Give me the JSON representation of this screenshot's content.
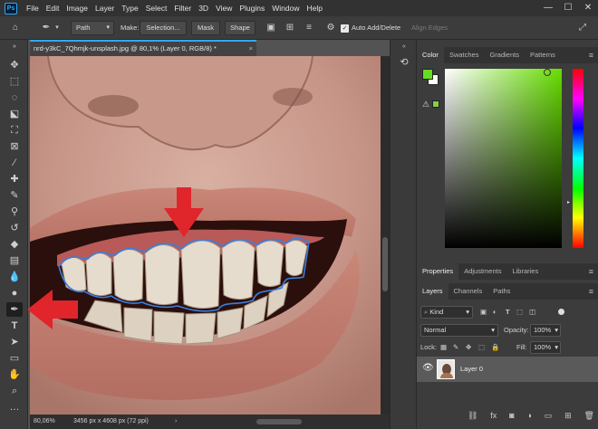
{
  "app": {
    "logo": "Ps"
  },
  "menu": [
    "File",
    "Edit",
    "Image",
    "Layer",
    "Type",
    "Select",
    "Filter",
    "3D",
    "View",
    "Plugins",
    "Window",
    "Help"
  ],
  "window_controls": {
    "minimize": "—",
    "maximize": "☐",
    "close": "✕"
  },
  "options": {
    "mode_value": "Path",
    "make_label": "Make:",
    "selection_label": "Selection...",
    "mask_label": "Mask",
    "shape_label": "Shape",
    "auto_add_delete_label": "Auto Add/Delete",
    "auto_add_delete_checked": true,
    "align_edges_label": "Align Edges"
  },
  "document": {
    "tab_title": "nrd-y3kC_7Qhmjk-unsplash.jpg @ 80,1% (Layer 0, RGB/8) *",
    "close": "×",
    "zoom": "80,06%",
    "info": "3456 px x 4608 px (72 ppi)"
  },
  "tools": [
    "move-icon",
    "marquee-icon",
    "lasso-icon",
    "object-select-icon",
    "crop-icon",
    "frame-icon",
    "eyedropper-icon",
    "healing-icon",
    "brush-icon",
    "stamp-icon",
    "history-brush-icon",
    "eraser-icon",
    "gradient-icon",
    "blur-icon",
    "dodge-icon",
    "pen-icon",
    "type-icon",
    "path-select-icon",
    "rectangle-icon",
    "hand-icon",
    "zoom-icon"
  ],
  "color_panel": {
    "tabs": [
      "Color",
      "Swatches",
      "Gradients",
      "Patterns"
    ],
    "active_tab": "Color",
    "foreground": "#66dd22",
    "background": "#ffffff",
    "web_safe_swatch": "#88cc44"
  },
  "properties_panel": {
    "tabs": [
      "Properties",
      "Adjustments",
      "Libraries"
    ],
    "active_tab": "Properties"
  },
  "layers_panel": {
    "tabs": [
      "Layers",
      "Channels",
      "Paths"
    ],
    "active_tab": "Layers",
    "filter_value": "Kind",
    "blend_mode": "Normal",
    "opacity_label": "Opacity:",
    "opacity_value": "100%",
    "lock_label": "Lock:",
    "fill_label": "Fill:",
    "fill_value": "100%",
    "layers": [
      {
        "name": "Layer 0",
        "visible": true
      }
    ]
  },
  "annotations": {
    "arrow_color": "#e0252b",
    "path_color": "#3b7ee0"
  }
}
